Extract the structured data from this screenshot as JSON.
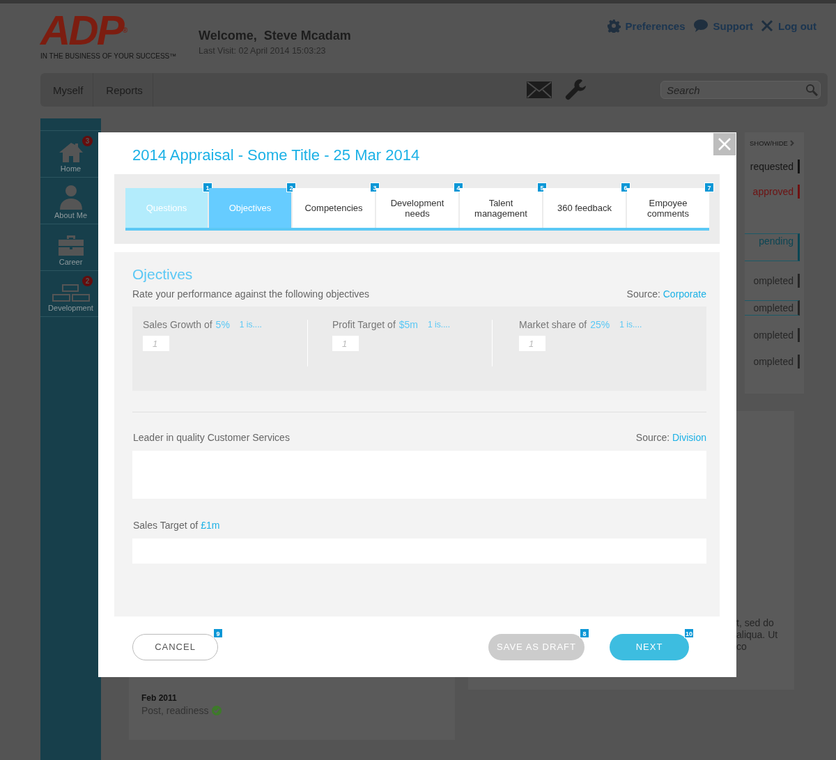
{
  "header": {
    "logo": {
      "text": "ADP",
      "mark": "®",
      "tagline": "IN THE BUSINESS OF YOUR SUCCESS™"
    },
    "welcome": "Welcome,  Steve Mcadam",
    "last_visit": "Last Visit: 02 April 2014 15:03:23",
    "links": [
      "Preferences",
      "Support",
      "Log out"
    ]
  },
  "nav": {
    "items": [
      "Myself",
      "Reports"
    ],
    "search": {
      "placeholder": "Search"
    }
  },
  "sidebar": {
    "items": [
      {
        "label": "Home",
        "badge": "3"
      },
      {
        "label": "About Me"
      },
      {
        "label": "Career"
      },
      {
        "label": "Development",
        "badge": "2"
      }
    ]
  },
  "status_panel": {
    "toggle": "SHOW/HIDE",
    "items": [
      {
        "label": "requested",
        "color": "#151515",
        "outlined": false
      },
      {
        "label": "approved",
        "color": "#6e1212",
        "outlined": false
      },
      {
        "label": "pending",
        "color": "#0c4654",
        "outlined": true
      },
      {
        "label": "ompleted",
        "color": "#262626",
        "outlined": false
      },
      {
        "label": "ompleted",
        "color": "#262626",
        "outlined": true
      },
      {
        "label": "ompleted",
        "color": "#262626",
        "outlined": false
      },
      {
        "label": "ompleted",
        "color": "#262626",
        "outlined": false
      }
    ]
  },
  "background_text": [
    "t, sed do",
    "aliqua. Ut",
    "co"
  ],
  "history": {
    "date": "Feb 2011",
    "status": "Post, readiness"
  },
  "modal": {
    "title": "2014 Appraisal - Some Title - 25 Mar 2014",
    "tabs": [
      {
        "number": "1",
        "label": "Questions",
        "completed": true,
        "selected": false
      },
      {
        "number": "2",
        "label": "Objectives",
        "completed": false,
        "selected": true
      },
      {
        "number": "3",
        "label": "Competencies",
        "completed": false,
        "selected": false
      },
      {
        "number": "4",
        "label": "Development needs",
        "completed": false,
        "selected": false
      },
      {
        "number": "5",
        "label": "Talent management",
        "completed": false,
        "selected": false
      },
      {
        "number": "6",
        "label": "360 feedback",
        "completed": false,
        "selected": false
      },
      {
        "number": "7",
        "label": "Empoyee comments",
        "completed": false,
        "selected": false
      }
    ],
    "section": {
      "heading": "Ojectives",
      "intro": "Rate your performance against the following objectives",
      "source_label": "Source:",
      "source": "Corporate",
      "ratings": [
        {
          "label": "Sales Growth of",
          "value": "5%",
          "hint": "1 is....",
          "placeholder": "1"
        },
        {
          "label": "Profit Target of",
          "value": "$5m",
          "hint": "1 is....",
          "placeholder": "1"
        },
        {
          "label": "Market share of",
          "value": "25%",
          "hint": "1 is....",
          "placeholder": "1"
        }
      ]
    },
    "objectives": [
      {
        "label": "Leader in quality Customer Services",
        "source_label": "Source:",
        "source": "Division",
        "kind": "tall"
      },
      {
        "label": "Sales Target of",
        "value": "£1m",
        "kind": "short"
      }
    ],
    "buttons": [
      {
        "label": "CANCEL",
        "number": "9",
        "kind": "outline",
        "disabled": false
      },
      {
        "label": "SAVE AS DRAFT",
        "number": "8",
        "kind": "filled",
        "disabled": true
      },
      {
        "label": "NEXT",
        "number": "10",
        "kind": "filled",
        "disabled": false
      }
    ]
  }
}
